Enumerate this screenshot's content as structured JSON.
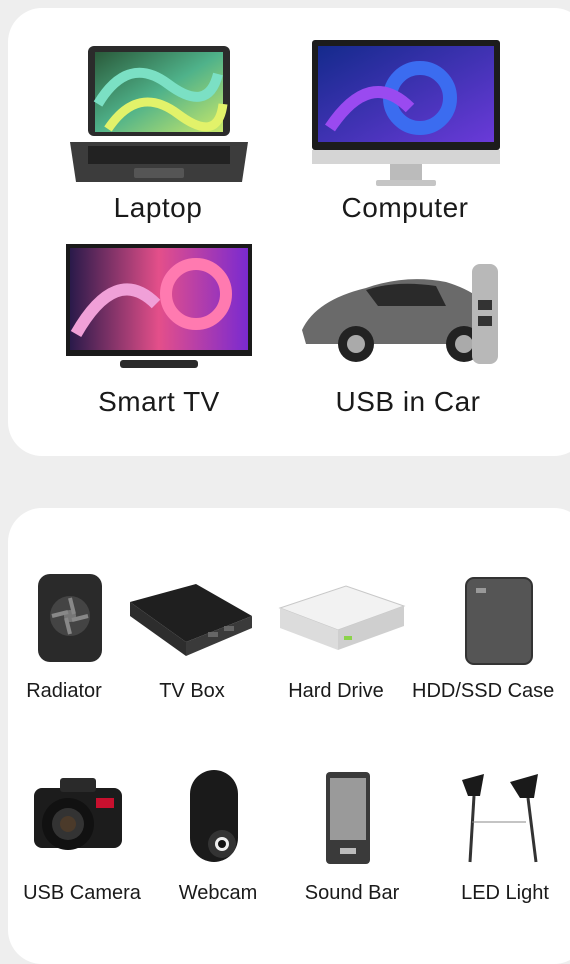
{
  "top_devices": [
    {
      "label": "Laptop",
      "icon": "laptop-icon"
    },
    {
      "label": "Computer",
      "icon": "computer-icon"
    },
    {
      "label": "Smart TV",
      "icon": "tv-icon"
    },
    {
      "label": "USB in Car",
      "icon": "car-icon"
    }
  ],
  "bottom_devices": [
    {
      "label": "Radiator",
      "icon": "radiator-icon"
    },
    {
      "label": "TV Box",
      "icon": "tv-box-icon"
    },
    {
      "label": "Hard Drive",
      "icon": "hard-drive-icon"
    },
    {
      "label": "HDD/SSD Case",
      "icon": "ssd-case-icon"
    },
    {
      "label": "USB Camera",
      "icon": "camera-icon"
    },
    {
      "label": "Webcam",
      "icon": "webcam-icon"
    },
    {
      "label": "Sound Bar",
      "icon": "sound-bar-icon"
    },
    {
      "label": "LED Light",
      "icon": "led-light-icon"
    }
  ]
}
